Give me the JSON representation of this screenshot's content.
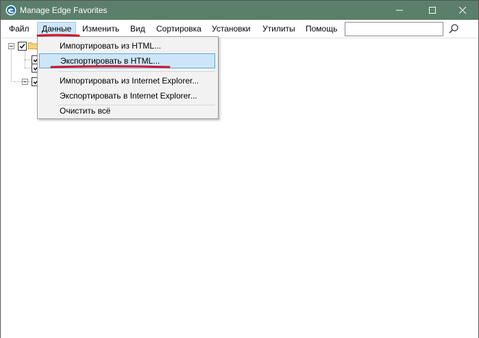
{
  "window": {
    "title": "Manage Edge Favorites",
    "titlebar_color": "#5b7f6a",
    "icon": "edge-favorites-app-icon"
  },
  "titlebar_buttons": {
    "minimize_icon": "minimize-icon",
    "maximize_icon": "maximize-icon",
    "close_icon": "close-icon"
  },
  "menu": {
    "items": [
      {
        "label": "Файл"
      },
      {
        "label": "Данные"
      },
      {
        "label": "Изменить"
      },
      {
        "label": "Вид"
      },
      {
        "label": "Сортировка"
      },
      {
        "label": "Установки"
      },
      {
        "label": "Утилиты"
      },
      {
        "label": "Помощь"
      }
    ],
    "active_index": 1
  },
  "search": {
    "value": "",
    "placeholder": "",
    "button_icon": "search-icon"
  },
  "dropdown": {
    "items": [
      {
        "label": "Импортировать из HTML..."
      },
      {
        "label": "Экспортировать в HTML..."
      },
      {
        "label": "Импортировать из Internet Explorer..."
      },
      {
        "label": "Экспортировать в Internet Explorer..."
      },
      {
        "label": "Очистить всё"
      }
    ],
    "highlighted_index": 1,
    "highlight_color": "#cde6f7"
  },
  "tree": {
    "root_checked": true,
    "children_checked": [
      true,
      true
    ],
    "third_node_checked": true
  },
  "annotation": {
    "underline_color": "#d0142c"
  }
}
